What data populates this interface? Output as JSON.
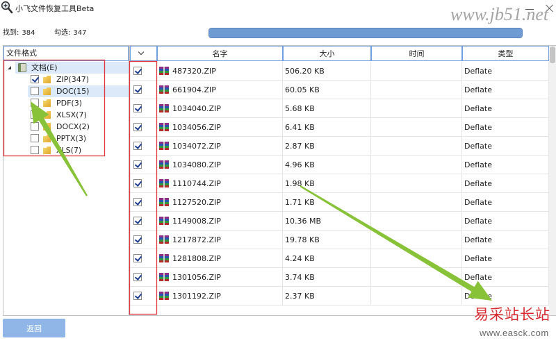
{
  "window": {
    "title": "小飞文件恢复工具Beta",
    "app_icon": "magnifier-plus-icon"
  },
  "stats": {
    "found_label": "找到:",
    "found_value": "384",
    "checked_label": "勾选:",
    "checked_value": "347"
  },
  "scan_progress": {
    "percent": 100
  },
  "format_panel": {
    "header": "文件格式",
    "root": {
      "label": "文档(E)",
      "expanded": true,
      "selected": true,
      "icon": "document-category-icon"
    },
    "items": [
      {
        "label": "ZIP(347)",
        "checked": true
      },
      {
        "label": "DOC(15)",
        "checked": false,
        "selected": true
      },
      {
        "label": "PDF(3)",
        "checked": false
      },
      {
        "label": "XLSX(7)",
        "checked": false
      },
      {
        "label": "DOCX(2)",
        "checked": false
      },
      {
        "label": "PPTX(3)",
        "checked": false
      },
      {
        "label": "XLS(7)",
        "checked": false
      }
    ]
  },
  "file_table": {
    "select_header_icon": "chevron-down-icon",
    "row_icon": "zip-archive-icon",
    "columns": {
      "name": "名字",
      "size": "大小",
      "time": "时间",
      "type": "类型"
    },
    "rows": [
      {
        "checked": true,
        "name": "487320.ZIP",
        "size": "506.20 KB",
        "type": "Deflate"
      },
      {
        "checked": true,
        "name": "661904.ZIP",
        "size": "60.05 KB",
        "type": "Deflate"
      },
      {
        "checked": true,
        "name": "1034040.ZIP",
        "size": "5.68 KB",
        "type": "Deflate"
      },
      {
        "checked": true,
        "name": "1034056.ZIP",
        "size": "6.41 KB",
        "type": "Deflate"
      },
      {
        "checked": true,
        "name": "1034072.ZIP",
        "size": "2.87 KB",
        "type": "Deflate"
      },
      {
        "checked": true,
        "name": "1034080.ZIP",
        "size": "4.96 KB",
        "type": "Deflate"
      },
      {
        "checked": true,
        "name": "1110744.ZIP",
        "size": "1.98 KB",
        "type": "Deflate"
      },
      {
        "checked": true,
        "name": "1127520.ZIP",
        "size": "1.71 KB",
        "type": "Deflate"
      },
      {
        "checked": true,
        "name": "1149008.ZIP",
        "size": "10.36 MB",
        "type": "Deflate"
      },
      {
        "checked": true,
        "name": "1217872.ZIP",
        "size": "19.78 KB",
        "type": "Deflate"
      },
      {
        "checked": true,
        "name": "1281808.ZIP",
        "size": "4.24 KB",
        "type": "Deflate"
      },
      {
        "checked": true,
        "name": "1301056.ZIP",
        "size": "3.74 KB",
        "type": "Deflate"
      },
      {
        "checked": true,
        "name": "1301192.ZIP",
        "size": "2.37 KB",
        "type": "Deflate"
      }
    ]
  },
  "footer": {
    "back_button": "返回"
  },
  "watermarks": {
    "site_top": "www.jb51.net",
    "site_bottom_title": "易采站长站",
    "site_bottom_url": "www.easck.com"
  },
  "colors": {
    "accent_border": "#6f9fe0",
    "progress_fill": "#6f9bd3",
    "button_bg": "#8fb6e6",
    "selection_bg": "#dce9f9",
    "checkmark": "#1c3d8f",
    "annotation_red": "#e0373c",
    "arrow_green": "#88c238",
    "watermark_red": "#d62a30"
  }
}
